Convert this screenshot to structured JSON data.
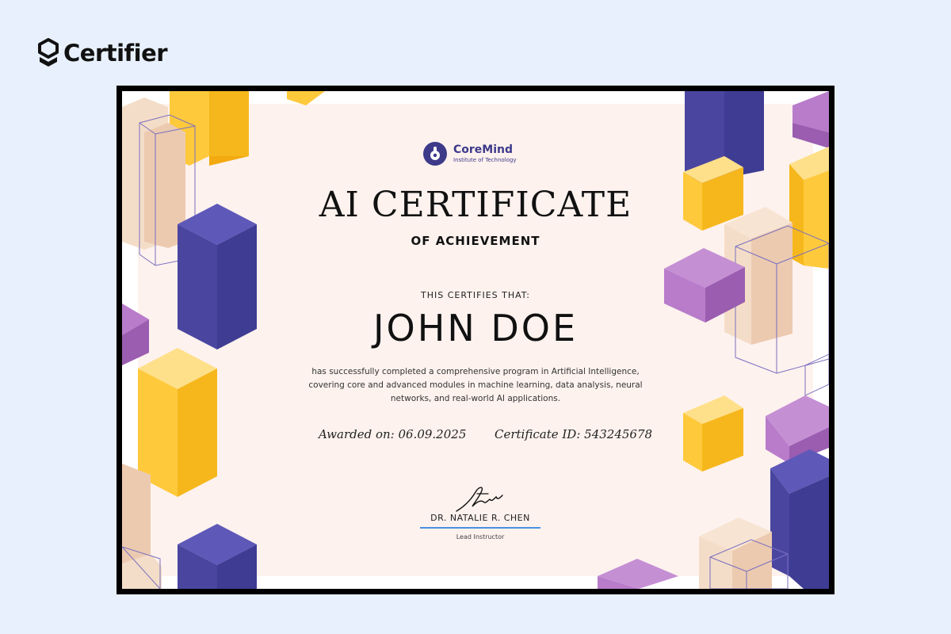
{
  "brand": {
    "name": "Certifier",
    "icon": "certifier-logo-icon"
  },
  "certificate": {
    "institution": {
      "name": "CoreMind",
      "subtitle": "Institute of Technology",
      "icon": "coremind-logo-icon"
    },
    "title": "AI CERTIFICATE",
    "subtitle": "OF ACHIEVEMENT",
    "certifies_text": "THIS CERTIFIES THAT:",
    "recipient": "JOHN DOE",
    "description": "has successfully completed a comprehensive program in Artificial Intelligence, covering core and advanced modules in machine learning, data analysis, neural networks, and real-world AI applications.",
    "awarded_on": "Awarded on: 06.09.2025",
    "certificate_id": "Certificate ID: 543245678",
    "signer": {
      "name": "DR. NATALIE R. CHEN",
      "role": "Lead Instructor",
      "icon": "signature-icon"
    }
  },
  "colors": {
    "page_background": "#e7f0fc",
    "certificate_panel": "#fdf2ee",
    "indigo": "#4a46a0",
    "yellow": "#ffc93c",
    "violet": "#a86bb9",
    "peach": "#efd2bd",
    "signature_line": "#4a90e2"
  }
}
